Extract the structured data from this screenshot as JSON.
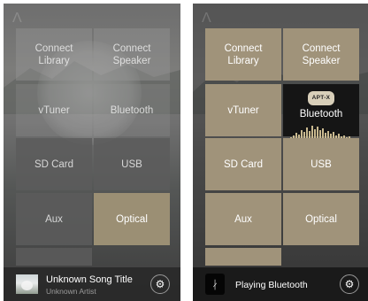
{
  "left_screen": {
    "tiles": {
      "connect_library": "Connect\nLibrary",
      "connect_speaker": "Connect\nSpeaker",
      "vtuner": "vTuner",
      "bluetooth": "Bluetooth",
      "sd_card": "SD Card",
      "usb": "USB",
      "aux": "Aux",
      "optical": "Optical"
    },
    "now_playing": {
      "title": "Unknown Song Title",
      "artist": "Unknown Artist"
    }
  },
  "right_screen": {
    "tiles": {
      "connect_library": "Connect\nLibrary",
      "connect_speaker": "Connect\nSpeaker",
      "vtuner": "vTuner",
      "bluetooth": "Bluetooth",
      "aptx_badge": "APT-X",
      "sd_card": "SD Card",
      "usb": "USB",
      "aux": "Aux",
      "optical": "Optical"
    },
    "now_playing": {
      "status": "Playing Bluetooth"
    }
  },
  "icons": {
    "settings": "gear-icon",
    "bluetooth": "bluetooth-icon"
  },
  "colors": {
    "active_tile": "#9b8f74",
    "gold_tile": "#a0937a",
    "dim_tile": "#8c8c8c",
    "bluetooth_tile": "#151515"
  }
}
